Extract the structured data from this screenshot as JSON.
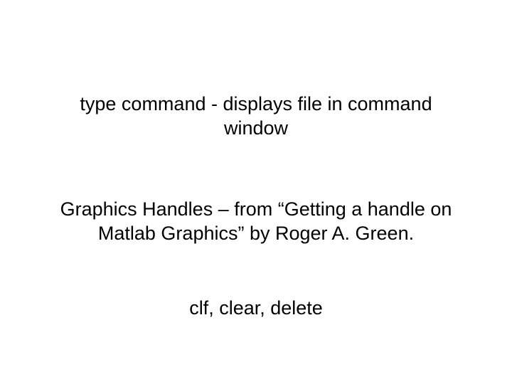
{
  "slide": {
    "para1_line1": "type command  - displays file in command",
    "para1_line2": "window",
    "para2_line1": "Graphics Handles – from “Getting a handle on",
    "para2_line2": "Matlab Graphics” by Roger A. Green.",
    "para3_line1": "clf, clear, delete"
  }
}
